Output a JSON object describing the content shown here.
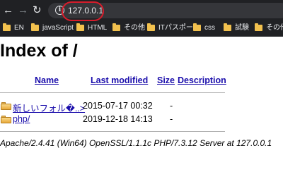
{
  "browser": {
    "url": "127.0.0.1",
    "bookmarks": [
      {
        "label": "EN"
      },
      {
        "label": "javaScript"
      },
      {
        "label": "HTML"
      },
      {
        "label": "その他"
      },
      {
        "label": "ITパスポート"
      },
      {
        "label": "css"
      },
      {
        "label": "試験"
      },
      {
        "label": "その他"
      }
    ]
  },
  "page": {
    "title": "Index of /",
    "columns": {
      "name": "Name",
      "last_modified": "Last modified",
      "size": "Size",
      "description": "Description"
    },
    "rows": [
      {
        "name": "新しいフォル�..>",
        "modified": "2015-07-17 00:32",
        "size": "-"
      },
      {
        "name": "php/",
        "modified": "2019-12-18 14:13",
        "size": "-"
      }
    ],
    "footer": "Apache/2.4.41 (Win64) OpenSSL/1.1.1c PHP/7.3.12 Server at 127.0.0.1"
  },
  "colors": {
    "chrome_bg": "#202124",
    "link": "#1a0dab",
    "annotation": "#d81c2b"
  }
}
